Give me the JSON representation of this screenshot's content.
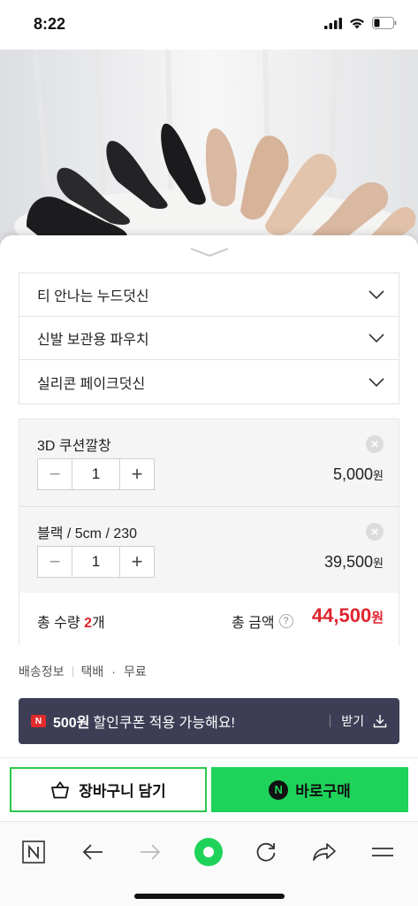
{
  "status_bar": {
    "time": "8:22"
  },
  "options": [
    {
      "label": "티 안나는 누드덧신"
    },
    {
      "label": "신발 보관용 파우치"
    },
    {
      "label": "실리콘 페이크덧신"
    }
  ],
  "selected_items": [
    {
      "name": "3D 쿠션깔창",
      "quantity": "1",
      "price": "5,000",
      "currency": "원",
      "minus": "−",
      "plus": "+"
    },
    {
      "name": "블랙 / 5cm / 230",
      "quantity": "1",
      "price": "39,500",
      "currency": "원",
      "minus": "−",
      "plus": "+"
    }
  ],
  "total": {
    "quantity_label": "총 수량",
    "quantity_value": "2",
    "quantity_unit": "개",
    "amount_label": "총 금액",
    "help_mark": "?",
    "amount_value": "44,500",
    "currency": "원"
  },
  "shipping": {
    "label": "배송정보",
    "method": "택배",
    "dot": "·",
    "fee": "무료"
  },
  "coupon": {
    "badge": "N",
    "amount": "500원",
    "message": "할인쿠폰 적용 가능해요!",
    "action": "받기"
  },
  "actions": {
    "cart_label": "장바구니 담기",
    "buy_badge": "N",
    "buy_label": "바로구매"
  },
  "colors": {
    "accent_green": "#1fd35a",
    "price_red": "#e0242f",
    "coupon_bg": "#3d3e55"
  }
}
